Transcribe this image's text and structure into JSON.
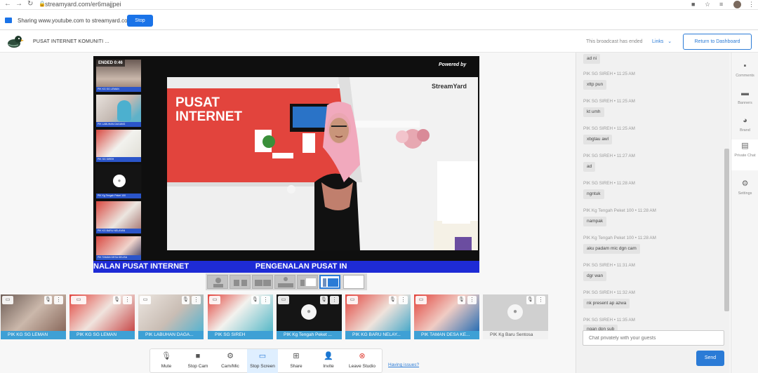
{
  "browser": {
    "url": "streamyard.com/er6majjpei"
  },
  "share_bar": {
    "text": "Sharing www.youtube.com to streamyard.com",
    "stop_label": "Stop"
  },
  "header": {
    "studio_title": "PUSAT INTERNET KOMUNITI ...",
    "status": "This broadcast has ended",
    "links_label": "Links",
    "return_label": "Return to Dashboard"
  },
  "stage": {
    "status_chip": "ENDED 0:46",
    "powered_by": "Powered by",
    "brand_logo": "StreamYard",
    "ticker_text": "NALAN PUSAT INTERNET                               PENGENALAN PUSAT IN",
    "thumbnails": [
      {
        "label": "PIK KG SG LEMAN"
      },
      {
        "label": "PIK LABUHAN DAGANG"
      },
      {
        "label": "PIK SG SIREH"
      },
      {
        "label": "PIK Kg Tengah Peket 100"
      },
      {
        "label": "PIK KG BARU NELAYAN"
      },
      {
        "label": "PIK TAMAN DESA KELISA"
      }
    ]
  },
  "tiles": [
    {
      "label": "PIK KG SG LEMAN",
      "on_stage": true
    },
    {
      "label": "PIK KG SG LEMAN",
      "on_stage": true
    },
    {
      "label": "PIK LABUHAN DAGA...",
      "on_stage": true
    },
    {
      "label": "PIK SG SIREH",
      "on_stage": true
    },
    {
      "label": "PIK Kg Tengah Peket ...",
      "on_stage": true
    },
    {
      "label": "PIK KG BARU NELAY...",
      "on_stage": true
    },
    {
      "label": "PIK TAMAN DESA KE...",
      "on_stage": true
    },
    {
      "label": "PIK Kg Baru Sentosa",
      "on_stage": false
    }
  ],
  "toolbar": {
    "items": [
      {
        "label": "Mute",
        "icon": "microphone-icon"
      },
      {
        "label": "Stop Cam",
        "icon": "camera-icon"
      },
      {
        "label": "Cam/Mic",
        "icon": "gear-icon"
      },
      {
        "label": "Stop Screen",
        "icon": "monitor-icon"
      },
      {
        "label": "Share",
        "icon": "plus-box-icon"
      },
      {
        "label": "Invite",
        "icon": "add-user-icon"
      },
      {
        "label": "Leave Studio",
        "icon": "close-circle-icon"
      }
    ],
    "issues_label": "Having issues?"
  },
  "chat": {
    "messages": [
      {
        "meta": "",
        "text": "ad ni"
      },
      {
        "meta": "PIK SG SIREH  •  11:25 AM",
        "text": "xttp pun"
      },
      {
        "meta": "PIK SG SIREH  •  11:25 AM",
        "text": "kt umh"
      },
      {
        "meta": "PIK SG SIREH  •  11:25 AM",
        "text": "xbgtau awl"
      },
      {
        "meta": "PIK SG SIREH  •  11:27 AM",
        "text": "ad"
      },
      {
        "meta": "PIK SG SIREH  •  11:28 AM",
        "text": "ngntuk"
      },
      {
        "meta": "PIK Kg Tengah Peket 100  •  11:28 AM",
        "text": "nampak"
      },
      {
        "meta": "PIK Kg Tengah Peket 100  •  11:28 AM",
        "text": "aku padam mic dgn cam"
      },
      {
        "meta": "PIK SG SIREH  •  11:31 AM",
        "text": "dgr wan"
      },
      {
        "meta": "PIK SG SIREH  •  11:32 AM",
        "text": "nk present ap azwa"
      },
      {
        "meta": "PIK SG SIREH  •  11:35 AM",
        "text": "ngan dpn sub"
      }
    ],
    "input_placeholder": "Chat privately with your guests",
    "send_label": "Send"
  },
  "rail": {
    "items": [
      {
        "label": "Comments",
        "icon": "comment-icon",
        "active": false
      },
      {
        "label": "Banners",
        "icon": "banner-icon",
        "active": false
      },
      {
        "label": "Brand",
        "icon": "palette-icon",
        "active": false
      },
      {
        "label": "Private Chat",
        "icon": "chat-icon",
        "active": true
      },
      {
        "label": "Settings",
        "icon": "gear-icon",
        "active": false
      }
    ]
  },
  "colors": {
    "accent": "#2b7bd6",
    "tile_label": "#3ea0d5",
    "ticker": "#1e2bd6",
    "studio_wall": "#e2443d"
  }
}
